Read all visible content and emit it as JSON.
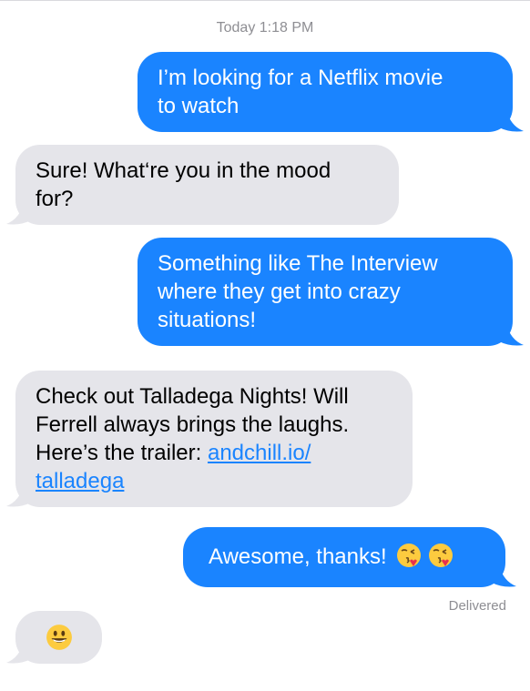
{
  "conversation": {
    "timestamp": "Today 1:18 PM",
    "messages": [
      {
        "from": "me",
        "lines": [
          "I’m looking for a Netflix movie",
          "to watch"
        ]
      },
      {
        "from": "them",
        "lines": [
          "Sure! What‘re you in the mood",
          "for?"
        ]
      },
      {
        "from": "me",
        "lines": [
          "Something like The Interview",
          "where they get into crazy",
          "situations!"
        ]
      },
      {
        "from": "them",
        "lines": [
          "Check out Talladega Nights! Will",
          "Ferrell always brings the laughs.",
          "Here’s the trailer: "
        ],
        "link_part1": "andchill.io/",
        "link_part2": "talladega"
      },
      {
        "from": "me",
        "text": "Awesome, thanks!",
        "emojis": [
          "face-throwing-kiss-icon",
          "face-throwing-kiss-icon"
        ]
      },
      {
        "from": "them",
        "emojis": [
          "grinning-face-icon"
        ]
      }
    ],
    "status": "Delivered"
  },
  "colors": {
    "outgoing_bubble": "#1a84ff",
    "incoming_bubble": "#e5e5ea",
    "meta_text": "#8e8e93"
  }
}
